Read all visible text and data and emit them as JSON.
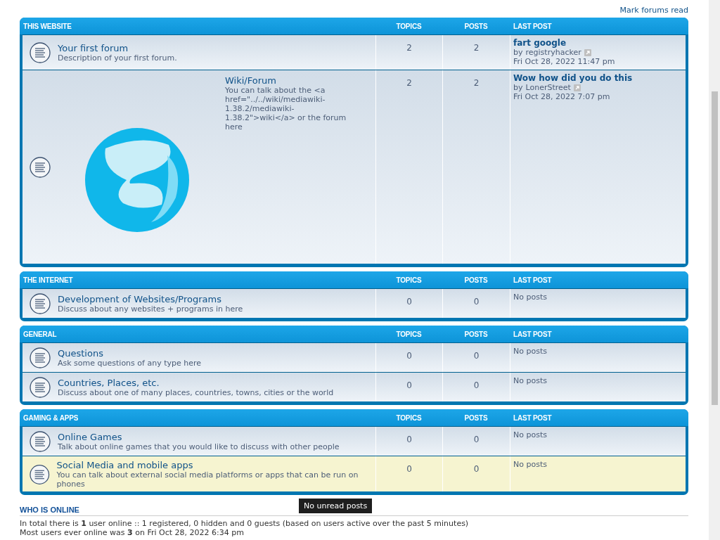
{
  "mark_read": "Mark forums read",
  "categories": [
    {
      "title": "THIS WEBSITE",
      "columns": {
        "topics": "TOPICS",
        "posts": "POSTS",
        "last_post": "LAST POST"
      },
      "forums": [
        {
          "title": "Your first forum",
          "description": "Description of your first forum.",
          "topics": "2",
          "posts": "2",
          "highlighted": false,
          "has_image": false,
          "last_post": {
            "kind": "post",
            "title": "fart google",
            "by": "by",
            "author": "registryhacker",
            "time": "Fri Oct 28, 2022 11:47 pm"
          }
        },
        {
          "title": "Wiki/Forum",
          "description": "You can talk about the <a href=\"../../wiki/mediawiki-1.38.2/mediawiki-1.38.2\">wiki</a> or the forum here",
          "topics": "2",
          "posts": "2",
          "highlighted": false,
          "has_image": true,
          "last_post": {
            "kind": "post",
            "title": "Wow how did you do this",
            "by": "by",
            "author": "LonerStreet",
            "time": "Fri Oct 28, 2022 7:07 pm"
          }
        }
      ]
    },
    {
      "title": "THE INTERNET",
      "columns": {
        "topics": "TOPICS",
        "posts": "POSTS",
        "last_post": "LAST POST"
      },
      "forums": [
        {
          "title": "Development of Websites/Programs",
          "description": "Discuss about any websites + programs in here",
          "topics": "0",
          "posts": "0",
          "highlighted": false,
          "has_image": false,
          "last_post": {
            "kind": "none",
            "text": "No posts"
          }
        }
      ]
    },
    {
      "title": "GENERAL",
      "columns": {
        "topics": "TOPICS",
        "posts": "POSTS",
        "last_post": "LAST POST"
      },
      "forums": [
        {
          "title": "Questions",
          "description": "Ask some questions of any type here",
          "topics": "0",
          "posts": "0",
          "highlighted": false,
          "has_image": false,
          "last_post": {
            "kind": "none",
            "text": "No posts"
          }
        },
        {
          "title": "Countries, Places, etc.",
          "description": "Discuss about one of many places, countries, towns, cities or the world",
          "topics": "0",
          "posts": "0",
          "highlighted": false,
          "has_image": false,
          "last_post": {
            "kind": "none",
            "text": "No posts"
          }
        }
      ]
    },
    {
      "title": "GAMING & APPS",
      "columns": {
        "topics": "TOPICS",
        "posts": "POSTS",
        "last_post": "LAST POST"
      },
      "forums": [
        {
          "title": "Online Games",
          "description": "Talk about online games that you would like to discuss with other people",
          "topics": "0",
          "posts": "0",
          "highlighted": false,
          "has_image": false,
          "last_post": {
            "kind": "none",
            "text": "No posts"
          }
        },
        {
          "title": "Social Media and mobile apps",
          "description": "You can talk about external social media platforms or apps that can be run on phones",
          "topics": "0",
          "posts": "0",
          "highlighted": true,
          "has_image": false,
          "last_post": {
            "kind": "none",
            "text": "No posts"
          }
        }
      ]
    }
  ],
  "tooltip": "No unread posts",
  "who_is_online": {
    "heading": "WHO IS ONLINE",
    "lines": [
      "In total there is **1** user online :: 1 registered, 0 hidden and 0 guests (based on users active over the past 5 minutes)",
      "Most users ever online was **3** on Fri Oct 28, 2022 6:34 pm"
    ]
  }
}
